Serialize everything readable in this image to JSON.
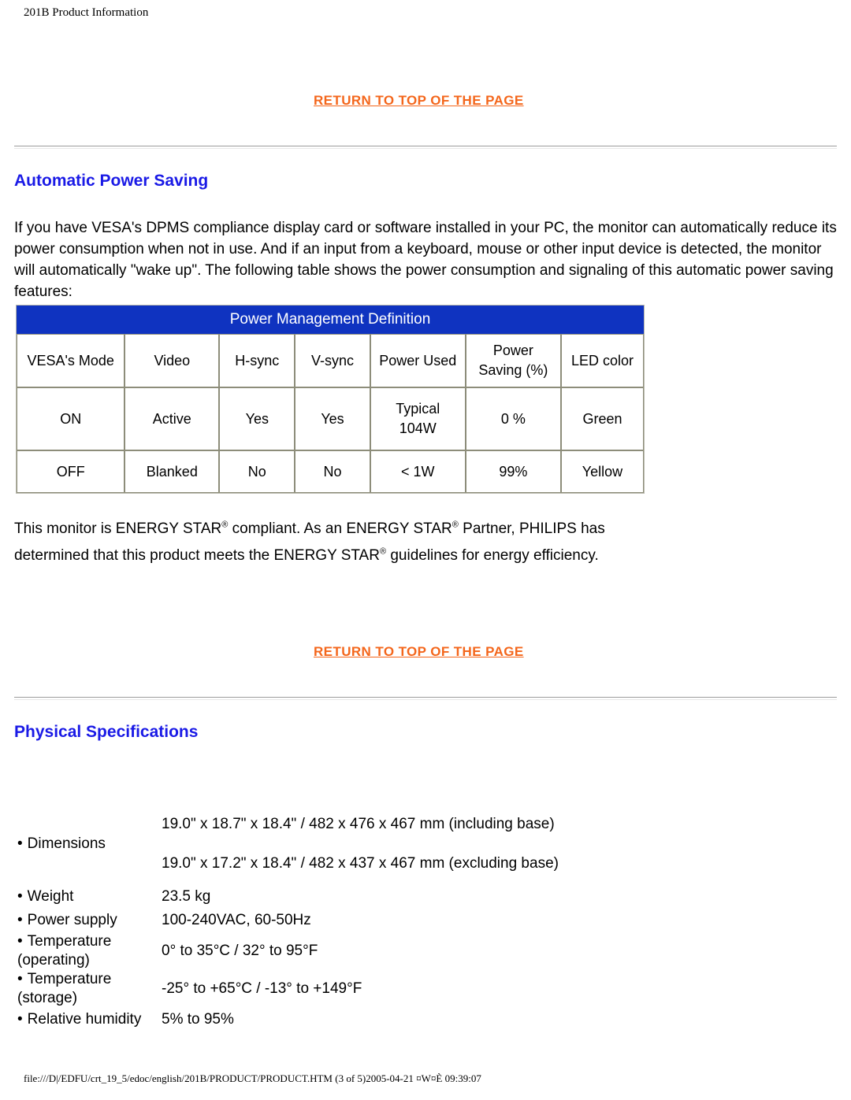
{
  "page": {
    "running_head": "201B Product Information",
    "footer": "file:///D|/EDFU/crt_19_5/edoc/english/201B/PRODUCT/PRODUCT.HTM (3 of 5)2005-04-21 ¤W¤È 09:39:07"
  },
  "colors": {
    "link": "#F4661B",
    "heading": "#1A1AE6",
    "table_header_bg": "#0F33C0",
    "table_border": "#8d8d7a",
    "text": "#000000"
  },
  "links": {
    "return_to_top_1": "RETURN TO TOP OF THE PAGE",
    "return_to_top_2": "RETURN TO TOP OF THE PAGE"
  },
  "sections": {
    "automatic_power_saving": {
      "title": "Automatic Power Saving",
      "intro": "If you have VESA's DPMS compliance display card or software installed in your PC, the monitor can automatically reduce its power consumption when not in use. And if an input from a keyboard, mouse or other input device is detected, the monitor will automatically \"wake up\". The following table shows the power consumption and signaling of this automatic power saving features:",
      "energy_star_line1_a": "This monitor is ENERGY STAR",
      "energy_star_line1_b": " compliant. As an ENERGY STAR",
      "energy_star_line1_c": " Partner, PHILIPS has",
      "energy_star_line2_a": "determined that this product meets the ENERGY STAR",
      "energy_star_line2_b": " guidelines for energy efficiency.",
      "registered_mark": "®"
    },
    "physical_specifications": {
      "title": "Physical Specifications"
    }
  },
  "power_table": {
    "caption": "Power Management Definition",
    "headers": [
      "VESA's Mode",
      "Video",
      "H-sync",
      "V-sync",
      "Power Used",
      "Power",
      "Saving (%)",
      "LED color"
    ],
    "rows": [
      {
        "mode": "ON",
        "video": "Active",
        "hsync": "Yes",
        "vsync": "Yes",
        "power_used_line1": "Typical",
        "power_used_line2": "104W",
        "power_saving": "0 %",
        "led_color": "Green"
      },
      {
        "mode": "OFF",
        "video": "Blanked",
        "hsync": "No",
        "vsync": "No",
        "power_used_line1": "< 1W",
        "power_used_line2": "",
        "power_saving": "99%",
        "led_color": "Yellow"
      }
    ]
  },
  "physical_specs": {
    "bullet": "•",
    "items": [
      {
        "label": "Dimensions",
        "value_line1": "19.0\" x 18.7\" x 18.4\" / 482 x 476 x 467 mm (including base)",
        "value_line2": "19.0\" x 17.2\" x 18.4\" / 482 x 437 x 467 mm (excluding base)"
      },
      {
        "label": "Weight",
        "value_line1": "23.5 kg",
        "value_line2": ""
      },
      {
        "label": "Power supply",
        "value_line1": "100-240VAC, 60-50Hz",
        "value_line2": ""
      },
      {
        "label_line1": "Temperature",
        "label_line2": "(operating)",
        "value_line1": "0° to 35°C / 32° to 95°F",
        "value_line2": ""
      },
      {
        "label_line1": "Temperature",
        "label_line2": "(storage)",
        "value_line1": "-25° to +65°C / -13° to +149°F",
        "value_line2": ""
      },
      {
        "label": "Relative humidity",
        "value_line1": "5% to 95%",
        "value_line2": ""
      }
    ]
  }
}
